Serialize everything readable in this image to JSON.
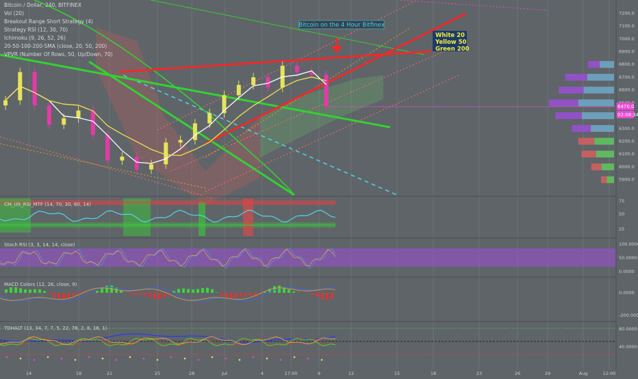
{
  "header": {
    "symbol_line": "Bitcoin / Dollar, 240, BITFINEX",
    "indicators": [
      "Vol (20)",
      "Breakout Range Short Strategy (4)",
      "Strategy RSI (12, 30, 70)",
      "Ichimoku (9, 26, 52, 26)",
      "20-50-100-200-SMA (close, 20, 50, 200)",
      "VPVR (Number Of Rows, 50, Up/Down, 70)"
    ]
  },
  "annotations": {
    "title_box": "Bitcoin on the 4 Hour Bitfinex",
    "legend_box": [
      "White 20",
      "Yellow 50",
      "Green 200"
    ]
  },
  "price_axis": {
    "ticks": [
      "7200.0",
      "7100.0",
      "7000.0",
      "6900.0",
      "6800.0",
      "6700.0",
      "6600.0",
      "6500.0",
      "6400.0",
      "6300.0",
      "6200.0",
      "6100.0",
      "6000.0",
      "5900.0"
    ],
    "current_price": "6470.0",
    "countdown": "02:08:34"
  },
  "panels": [
    {
      "label": "CM_Ult_RSI_MTF (14, 70, 30, 60, 14)",
      "ticks": [
        "75",
        "50",
        "25"
      ]
    },
    {
      "label": "Stoch RSI (3, 3, 14, 14, close)",
      "ticks": [
        "100.0000",
        "50.0000",
        "0.0000"
      ]
    },
    {
      "label": "MACD Colors (12, 26, close, 9)",
      "ticks": [
        "0.0000",
        "-200.0000"
      ]
    },
    {
      "label": "TDHALT (13, 34, 7, 7, 5, 22, 78, 2, 8, 16, 1)",
      "ticks": [
        "80.0000",
        "40.0000"
      ]
    }
  ],
  "time_axis": [
    "14",
    "18",
    "21",
    "25",
    "28",
    "Jul",
    "4",
    "17:00",
    "9",
    "12",
    "15",
    "18",
    "23",
    "26",
    "29",
    "Aug",
    "12:00"
  ],
  "colors": {
    "background": "#5f6468",
    "bull_candle": "#e6e45a",
    "bear_candle": "#e43aa7",
    "sma20": "#ffffff",
    "sma50": "#f0e052",
    "sma200": "#33d233",
    "trend_red": "#ef2a2a",
    "title_box_text": "#33d8e8",
    "legend_box_bg": "#1e3a6a",
    "legend_text": "#f4ef3a"
  },
  "chart_data": {
    "type": "candlestick",
    "symbol": "BTCUSD",
    "exchange": "BITFINEX",
    "interval": "240",
    "ylim": [
      5850,
      7250
    ],
    "x_categories": [
      "14",
      "18",
      "21",
      "25",
      "28",
      "Jul",
      "4",
      "17:00",
      "9",
      "12",
      "15",
      "18",
      "23",
      "26",
      "29",
      "Aug",
      "12:00"
    ],
    "close_series": [
      6520,
      6740,
      6480,
      6330,
      6380,
      6440,
      6250,
      6050,
      6080,
      5980,
      6020,
      6190,
      6210,
      6340,
      6420,
      6560,
      6640,
      6700,
      6620,
      6790,
      6740,
      6720,
      6470
    ],
    "last_price": 6470.0,
    "vpvr_levels": [
      {
        "price": 6800,
        "volume": 0.4
      },
      {
        "price": 6700,
        "volume": 0.75
      },
      {
        "price": 6600,
        "volume": 0.85
      },
      {
        "price": 6500,
        "volume": 1.0
      },
      {
        "price": 6400,
        "volume": 0.9
      },
      {
        "price": 6300,
        "volume": 0.65
      },
      {
        "price": 6200,
        "volume": 0.55
      },
      {
        "price": 6100,
        "volume": 0.5
      },
      {
        "price": 6000,
        "volume": 0.35
      },
      {
        "price": 5900,
        "volume": 0.2
      }
    ],
    "grid": true
  }
}
